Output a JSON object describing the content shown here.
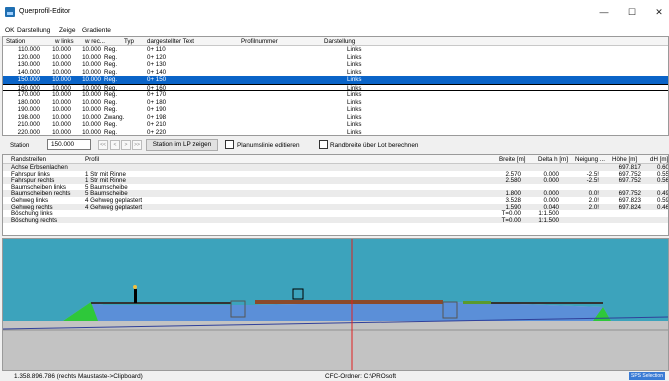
{
  "window": {
    "title": "Querprofil-Editor",
    "minimize": "—",
    "maximize": "☐",
    "close": "✕"
  },
  "menu": [
    "OK",
    "Darstellung",
    "Zeige",
    "Gradiente"
  ],
  "grid": {
    "headers": [
      "Station",
      "w links",
      "w rec...",
      "Typ",
      "dargestellter Text",
      "Profilnummer",
      "Darstellung"
    ],
    "rows": [
      [
        "110.000",
        "10.000",
        "10.000",
        "Reg.",
        "0+ 110",
        "",
        "Links"
      ],
      [
        "120.000",
        "10.000",
        "10.000",
        "Reg.",
        "0+ 120",
        "",
        "Links"
      ],
      [
        "130.000",
        "10.000",
        "10.000",
        "Reg.",
        "0+ 130",
        "",
        "Links"
      ],
      [
        "140.000",
        "10.000",
        "10.000",
        "Reg.",
        "0+ 140",
        "",
        "Links"
      ],
      [
        "150.000",
        "10.000",
        "10.000",
        "Reg.",
        "0+ 150",
        "",
        "Links"
      ],
      [
        "160.000",
        "10.000",
        "10.000",
        "Reg.",
        "0+ 160",
        "",
        "Links"
      ],
      [
        "170.000",
        "10.000",
        "10.000",
        "Reg.",
        "0+ 170",
        "",
        "Links"
      ],
      [
        "180.000",
        "10.000",
        "10.000",
        "Reg.",
        "0+ 180",
        "",
        "Links"
      ],
      [
        "190.000",
        "10.000",
        "10.000",
        "Reg.",
        "0+ 190",
        "",
        "Links"
      ],
      [
        "198.000",
        "10.000",
        "10.000",
        "Zwang.",
        "0+ 198",
        "",
        "Links"
      ],
      [
        "210.000",
        "10.000",
        "10.000",
        "Reg.",
        "0+ 210",
        "",
        "Links"
      ],
      [
        "220.000",
        "10.000",
        "10.000",
        "Reg.",
        "0+ 220",
        "",
        "Links"
      ]
    ],
    "selected_index": 4
  },
  "toolbar": {
    "station_label": "Station",
    "station_value": "150.000",
    "nav": [
      "<<",
      "<",
      ">",
      ">>"
    ],
    "station_lp_button": "Station im LP zeigen",
    "planum_label": "Planumslinie editieren",
    "randbreite_label": "Randbreite über Lot berechnen"
  },
  "table2": {
    "headers": [
      "Randstreifen",
      "Profil",
      "Breite [m]",
      "Delta h [m]",
      "Neigung ...",
      "Höhe [m]",
      "dH [m]"
    ],
    "rows": [
      [
        "Achse Erbsenlachen",
        "",
        "",
        "",
        "",
        "697.817",
        "0.60"
      ],
      [
        "Fahrspur links",
        "1 Str mit Rinne",
        "2.570",
        "0.000",
        "-2.5!",
        "697.752",
        "0.55"
      ],
      [
        "Fahrspur rechts",
        "1 Str mit Rinne",
        "2.580",
        "0.000",
        "-2.5!",
        "697.752",
        "0.56"
      ],
      [
        "Baumscheiben links",
        "5 Baumscheibe",
        "",
        "",
        "",
        "",
        ""
      ],
      [
        "Baumscheiben rechts",
        "5 Baumscheibe",
        "1.800",
        "0.000",
        "0.0!",
        "697.752",
        "0.49"
      ],
      [
        "Gehweg links",
        "4 Gehweg geplastert",
        "3.528",
        "0.000",
        "2.0!",
        "697.823",
        "0.59"
      ],
      [
        "Gehweg rechts",
        "4 Gehweg geplastert",
        "1.590",
        "0.040",
        "2.0!",
        "697.824",
        "0.46"
      ],
      [
        "Böschung links",
        "",
        "T=0.00",
        "1:1.500",
        "",
        "",
        ""
      ],
      [
        "Böschung rechts",
        "",
        "T=0.00",
        "1:1.500",
        "",
        "",
        ""
      ]
    ]
  },
  "plot": {
    "colors": {
      "sky": "#3ca3bc",
      "ground": "#c3c3c3",
      "fill_blue": "#5b8fd8",
      "road": "#8b4a2a",
      "green": "#2ec83a",
      "red_line": "#e02020"
    }
  },
  "status": {
    "coords": "1.358.896.786 (rechts Maustaste->Clipboard)",
    "folder": "CFC-Ordner: C:\\PROsoft",
    "badge": "SPS Selection"
  }
}
